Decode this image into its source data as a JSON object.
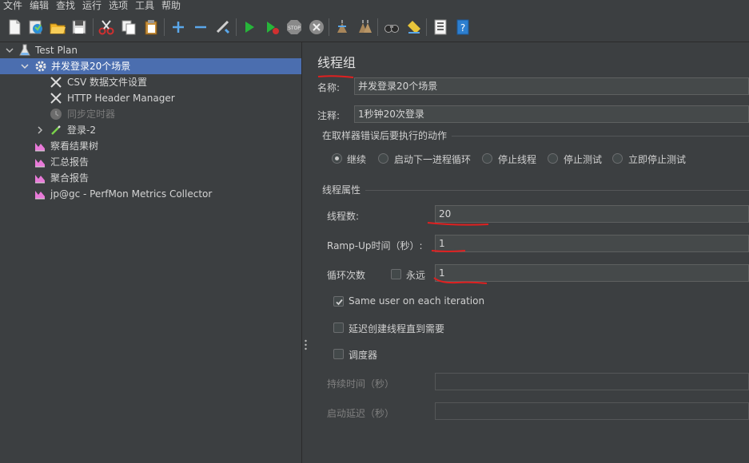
{
  "menu": [
    "文件",
    "编辑",
    "查找",
    "运行",
    "选项",
    "工具",
    "帮助"
  ],
  "toolbar_icons": [
    "new-file-icon",
    "templates-icon",
    "open-icon",
    "save-icon",
    "cut-icon",
    "copy-icon",
    "paste-icon",
    "expand-icon",
    "collapse-icon",
    "toggle-icon",
    "start-icon",
    "start-no-pause-icon",
    "stop-icon",
    "shutdown-icon",
    "clear-icon",
    "clear-all-icon",
    "search-icon",
    "reset-search-icon",
    "function-helper-icon",
    "help-icon"
  ],
  "tree": {
    "test_plan": "Test Plan",
    "thread_group": "并发登录20个场景",
    "csv": "CSV 数据文件设置",
    "header_manager": "HTTP Header Manager",
    "sync_timer": "同步定时器",
    "login": "登录-2",
    "view_results": "察看结果树",
    "summary": "汇总报告",
    "aggregate": "聚合报告",
    "perfmon": "jp@gc - PerfMon Metrics Collector"
  },
  "panel": {
    "title": "线程组",
    "name_label": "名称:",
    "name_value": "并发登录20个场景",
    "comment_label": "注释:",
    "comment_value": "1秒钟20次登录",
    "error_action_title": "在取样器错误后要执行的动作",
    "error_actions": [
      "继续",
      "启动下一进程循环",
      "停止线程",
      "停止测试",
      "立即停止测试"
    ],
    "error_action_selected": "继续",
    "thread_props_title": "线程属性",
    "threads_label": "线程数:",
    "threads_value": "20",
    "rampup_label": "Ramp-Up时间（秒）:",
    "rampup_value": "1",
    "loop_label": "循环次数",
    "forever_label": "永远",
    "forever_checked": false,
    "loop_value": "1",
    "same_user_label": "Same user on each iteration",
    "same_user_checked": true,
    "delay_create_label": "延迟创建线程直到需要",
    "delay_create_checked": false,
    "scheduler_label": "调度器",
    "scheduler_checked": false,
    "duration_label": "持续时间（秒）",
    "startup_delay_label": "启动延迟（秒）"
  },
  "colors": {
    "background": "#3c3f41",
    "selection": "#4b6eaf",
    "annotation": "#e02020"
  }
}
